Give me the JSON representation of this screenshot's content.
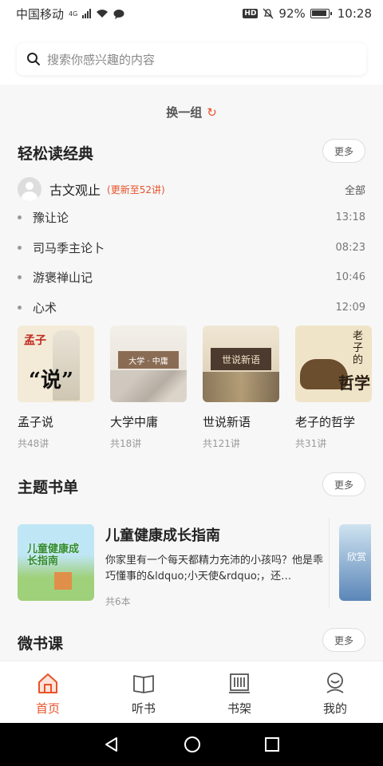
{
  "status": {
    "carrier": "中国移动",
    "network": "4G",
    "battery": "92%",
    "time": "10:28",
    "hd": "HD"
  },
  "search": {
    "placeholder": "搜索你感兴趣的内容"
  },
  "refresh": {
    "label": "换一组"
  },
  "classics": {
    "title": "轻松读经典",
    "more": "更多",
    "series": {
      "name": "古文观止",
      "badge": "(更新至52讲)",
      "all": "全部"
    },
    "episodes": [
      {
        "title": "豫让论",
        "duration": "13:18"
      },
      {
        "title": "司马季主论卜",
        "duration": "08:23"
      },
      {
        "title": "游褒禅山记",
        "duration": "10:46"
      },
      {
        "title": "心术",
        "duration": "12:09"
      }
    ],
    "books": [
      {
        "name": "孟子说",
        "count": "共48讲",
        "cover_text_1": "孟子",
        "cover_text_2": "“说”"
      },
      {
        "name": "大学中庸",
        "count": "共18讲",
        "cover_text": "大学 · 中庸"
      },
      {
        "name": "世说新语",
        "count": "共121讲",
        "cover_text": "世说新语"
      },
      {
        "name": "老子的哲学",
        "count": "共31讲",
        "cover_text_1": "老子的",
        "cover_text_2": "哲学"
      }
    ]
  },
  "topics": {
    "title": "主题书单",
    "more": "更多",
    "item": {
      "title": "儿童健康成长指南",
      "desc": "你家里有一个每天都精力充沛的小孩吗？他是乖巧懂事的&ldquo;小天使&rdquo;，还…",
      "count": "共6本",
      "cover_text": "儿童健康成长指南"
    },
    "next_cover_text": "欣赏"
  },
  "micro": {
    "title": "微书课",
    "more": "更多"
  },
  "tabs": [
    {
      "label": "首页",
      "icon": "home-icon",
      "active": true
    },
    {
      "label": "听书",
      "icon": "book-icon",
      "active": false
    },
    {
      "label": "书架",
      "icon": "bookshelf-icon",
      "active": false
    },
    {
      "label": "我的",
      "icon": "user-icon",
      "active": false
    }
  ],
  "colors": {
    "accent": "#e8522a"
  }
}
